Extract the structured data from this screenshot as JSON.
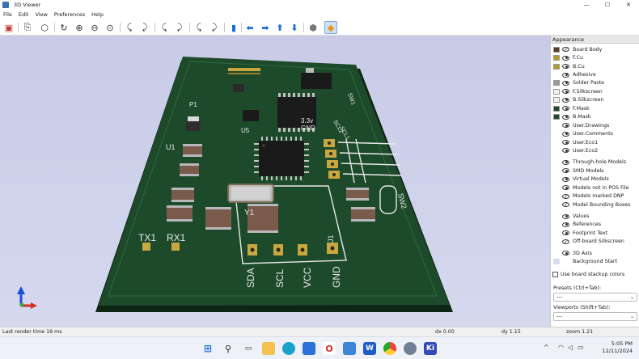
{
  "window": {
    "title": "3D Viewer",
    "minimize": "—",
    "maximize": "☐",
    "close": "✕"
  },
  "menus": [
    "File",
    "Edit",
    "View",
    "Preferences",
    "Help"
  ],
  "toolbar": {
    "icons": [
      "render-icon",
      "copy-icon",
      "reload-icon",
      "refresh-icon",
      "zoom-in-icon",
      "zoom-out-icon",
      "zoom-fit-icon",
      "rotate-x-cw-icon",
      "rotate-x-ccw-icon",
      "rotate-y-cw-icon",
      "rotate-y-ccw-icon",
      "rotate-z-cw-icon",
      "rotate-z-ccw-icon",
      "flip-board-icon",
      "pan-left-icon",
      "pan-right-icon",
      "pan-up-icon",
      "pan-down-icon",
      "orthographic-icon",
      "layers-toggle-icon"
    ]
  },
  "board": {
    "refs": [
      "P1",
      "U1",
      "U5",
      "Y1",
      "TX1",
      "RX1",
      "SW1",
      "SW2",
      "J1"
    ],
    "labels": {
      "p1": "P1",
      "u1": "U1",
      "u5": "U5",
      "y1": "Y1",
      "tx1": "TX1",
      "rx1": "RX1",
      "sw1": "SW1",
      "sw2": "SW2",
      "v33": "3.3v",
      "gnd1": "GND",
      "scl2": "SCL2",
      "scl1": "SCL1",
      "sda": "SDA",
      "scl": "SCL",
      "vcc": "VCC",
      "gnd": "GND",
      "j1": "J1"
    }
  },
  "panel": {
    "title": "Appearance",
    "layers": [
      {
        "name": "Board Body",
        "swatch": "#5a3b2a",
        "eye": "slash"
      },
      {
        "name": "F.Cu",
        "swatch": "#b59a2a",
        "eye": "on"
      },
      {
        "name": "B.Cu",
        "swatch": "#b59a2a",
        "eye": "on"
      },
      {
        "name": "Adhesive",
        "swatch": "",
        "eye": "on"
      },
      {
        "name": "Solder Paste",
        "swatch": "#9a9a9a",
        "eye": "on"
      },
      {
        "name": "F.Silkscreen",
        "swatch": "#f0f0f0",
        "eye": "on"
      },
      {
        "name": "B.Silkscreen",
        "swatch": "#f0f0f0",
        "eye": "on"
      },
      {
        "name": "F.Mask",
        "swatch": "#1f4a2a",
        "eye": "on"
      },
      {
        "name": "B.Mask",
        "swatch": "#1f4a2a",
        "eye": "on"
      },
      {
        "name": "User.Drawings",
        "swatch": "",
        "eye": "on"
      },
      {
        "name": "User.Comments",
        "swatch": "",
        "eye": "on"
      },
      {
        "name": "User.Eco1",
        "swatch": "",
        "eye": "on"
      },
      {
        "name": "User.Eco2",
        "swatch": "",
        "eye": "on"
      }
    ],
    "models": [
      "Through-hole Models",
      "SMD Models",
      "Virtual Models",
      "Models not in POS File",
      "Models marked DNP",
      "Model Bounding Boxes"
    ],
    "texts": [
      "Values",
      "References",
      "Footprint Text",
      "Off-board Silkscreen"
    ],
    "axis": "3D Axis",
    "background_start": "Background Start",
    "stackup_label": "Use board stackup colors",
    "presets_label": "Presets (Ctrl+Tab):",
    "presets_value": "---",
    "viewports_label": "Viewports (Shift+Tab):",
    "viewports_value": "---"
  },
  "status": {
    "render_time": "Last render time 19 ms",
    "dx": "dx 0.00",
    "dy": "dy 1.15",
    "zoom": "zoom 1.21"
  },
  "taskbar": {
    "apps": [
      "windows-start-icon",
      "search-icon",
      "task-view-icon",
      "file-explorer-icon",
      "edge-browser-icon",
      "store-icon",
      "opera-icon",
      "notepad-icon",
      "word-icon",
      "chrome-icon",
      "settings-icon",
      "kicad-icon"
    ],
    "kicad_label": "Ki",
    "tray_arrow": "^",
    "time": "5:05 PM",
    "date": "12/11/2024"
  },
  "colors": {
    "board": "#1d4a2b",
    "board_dark": "#0f2b18",
    "pad": "#c8a640",
    "silk": "#e8e8e8",
    "accent": "#1e6fd8"
  }
}
